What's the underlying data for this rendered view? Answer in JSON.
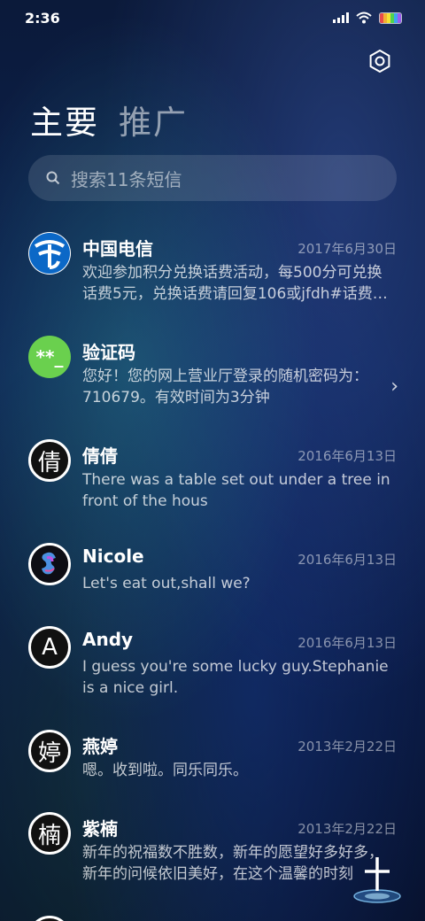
{
  "status": {
    "time": "2:36"
  },
  "tabs": {
    "primary": "主要",
    "promo": "推广"
  },
  "search": {
    "placeholder": "搜索11条短信"
  },
  "messages": [
    {
      "name": "中国电信",
      "date": "2017年6月30日",
      "snippet": "欢迎参加积分兑换话费活动，每500分可兑换话费5元，兑换话费请回复106或jfdh#话费…",
      "avatar": "telecom-logo"
    },
    {
      "name": "验证码",
      "date": "",
      "snippet": "您好！您的网上营业厅登录的随机密码为：710679。有效时间为3分钟",
      "avatar_text": "**_"
    },
    {
      "name": "倩倩",
      "date": "2016年6月13日",
      "snippet": "There was a table set out under a tree in front of the hous",
      "avatar_text": "倩"
    },
    {
      "name": "Nicole",
      "date": "2016年6月13日",
      "snippet": "Let's eat out,shall we?",
      "avatar": "photo"
    },
    {
      "name": "Andy",
      "date": "2016年6月13日",
      "snippet": "I guess you're some lucky guy.Stephanie is a nice girl.",
      "avatar_text": "A"
    },
    {
      "name": "燕婷",
      "date": "2013年2月22日",
      "snippet": "嗯。收到啦。同乐同乐。",
      "avatar_text": "婷"
    },
    {
      "name": "紫楠",
      "date": "2013年2月22日",
      "snippet": "新年的祝福数不胜数，新年的愿望好多好多，新年的问候依旧美好，在这个温馨的时刻",
      "avatar_text": "楠"
    }
  ],
  "colors": {
    "accent": "#6ad04e",
    "telecom": "#0b68c7"
  }
}
